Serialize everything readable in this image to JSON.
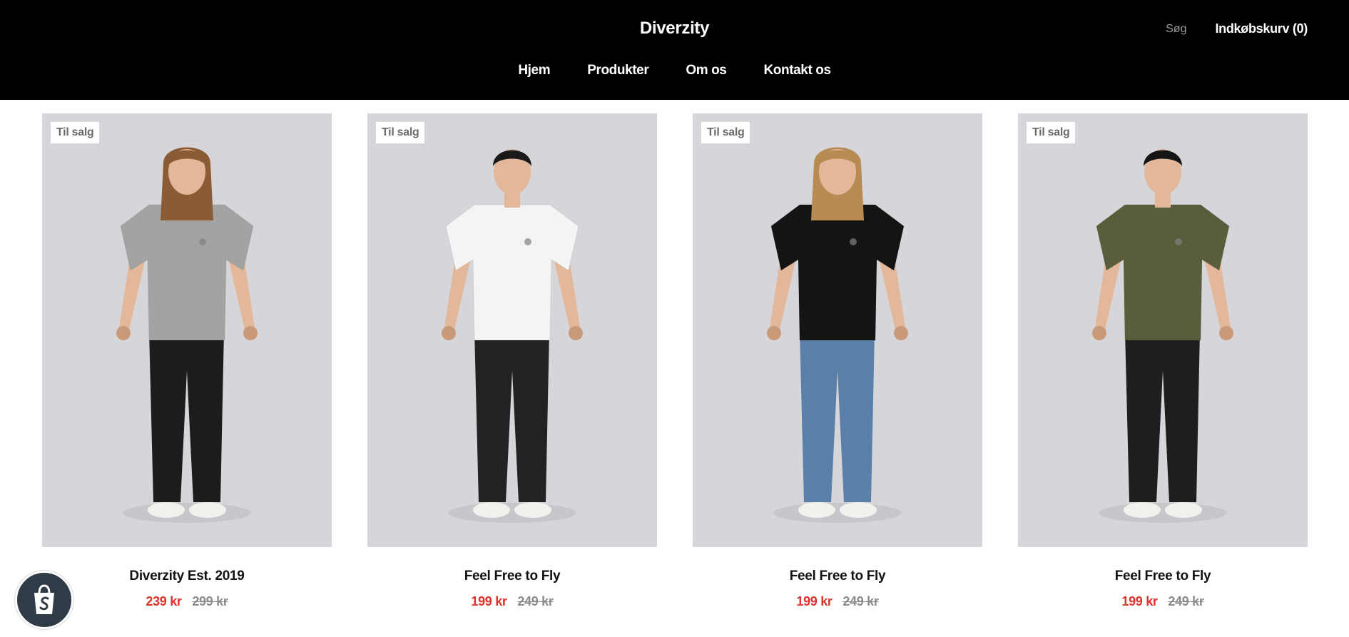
{
  "header": {
    "logo": "Diverzity",
    "search_label": "Søg",
    "cart_label": "Indkøbskurv (0)"
  },
  "nav": {
    "items": [
      "Hjem",
      "Produkter",
      "Om os",
      "Kontakt os"
    ]
  },
  "products": [
    {
      "badge": "Til salg",
      "title": "Diverzity Est. 2019",
      "sale_price": "239 kr",
      "compare_price": "299 kr",
      "shirt_color": "#a3a3a1",
      "pants_color": "#1c1c1c",
      "hair_color": "#8a5b35",
      "image": "woman-grey-tshirt"
    },
    {
      "badge": "Til salg",
      "title": "Feel Free to Fly",
      "sale_price": "199 kr",
      "compare_price": "249 kr",
      "shirt_color": "#f4f4f4",
      "pants_color": "#222222",
      "hair_color": "#1a1a1a",
      "image": "man-white-tshirt"
    },
    {
      "badge": "Til salg",
      "title": "Feel Free to Fly",
      "sale_price": "199 kr",
      "compare_price": "249 kr",
      "shirt_color": "#141414",
      "pants_color": "#5a7fa8",
      "hair_color": "#b98b54",
      "image": "woman-black-tshirt"
    },
    {
      "badge": "Til salg",
      "title": "Feel Free to Fly",
      "sale_price": "199 kr",
      "compare_price": "249 kr",
      "shirt_color": "#5a5d3c",
      "pants_color": "#1e1e1e",
      "hair_color": "#151515",
      "image": "man-olive-tshirt"
    }
  ],
  "colors": {
    "header_bg": "#000000",
    "sale": "#e0312a",
    "compare": "#8b8b8b",
    "photo_bg": "#d6d5da"
  },
  "shopify_badge": {
    "icon": "shopify-bag-icon"
  }
}
